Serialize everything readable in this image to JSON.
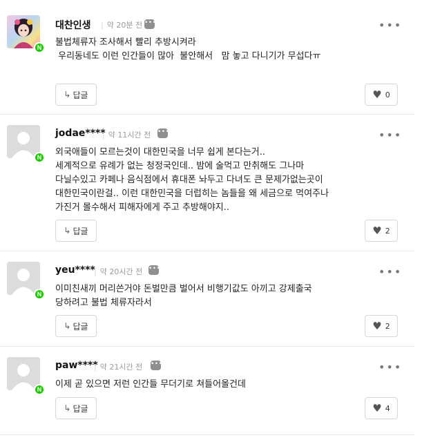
{
  "comments": [
    {
      "nickname": "대찬인생",
      "time": "약 20분 전",
      "text": "불법체류자 조사해서 빨리 추방시켜라\n 우리동네도 이런 인간들이 많아  불안해서   맘 놓고 다니기가 무섭다ㅠ",
      "reply_label": "답글",
      "likes": "0",
      "avatar": "profile-photo"
    },
    {
      "nickname": "jodae****",
      "time": "약 11시간 전",
      "text": "외국애들이 모르는것이 대한민국을 너무 쉽게 본다는거..\n세계적으로 유례가 없는 청정국인데.. 밤에 술먹고 만취해도 그나마 다닐수있고 카페나 음식점에서 휴대폰 놔두고 다녀도 큰 문제가없는곳이 대한민국이란걸.. 이런 대한민국을 더럽히는 놈들을 왜 세금으로 먹여주나 가진거 몰수해서 피해자에게 주고 추방해야지..",
      "reply_label": "답글",
      "likes": "2",
      "avatar": "default"
    },
    {
      "nickname": "yeu****",
      "time": "약 20시간 전",
      "text": "이미친새끼 머리쓴거야 돈벌만큼 벌어서 비행기값도 아끼고 강제출국 당하려고 불법 체류자라서",
      "reply_label": "답글",
      "likes": "2",
      "avatar": "default"
    },
    {
      "nickname": "paw****",
      "time": "약 21시간 전",
      "text": "이제 곧 있으면 저런 인간들 무더기로 쳐들어올건데",
      "reply_label": "답글",
      "likes": "4",
      "avatar": "default"
    }
  ],
  "badge_letter": "N",
  "bubble_icon_glyph": "•••",
  "more_glyph": "•••",
  "icons": {
    "reply": "reply-arrow-icon",
    "like": "heart-icon",
    "more": "more-dots-icon",
    "naver": "naver-n-badge",
    "comment": "comment-bubble-icon"
  },
  "colors": {
    "naver_green": "#1ec800",
    "muted_text": "#9a9a9a",
    "border": "#d6d6d6"
  }
}
